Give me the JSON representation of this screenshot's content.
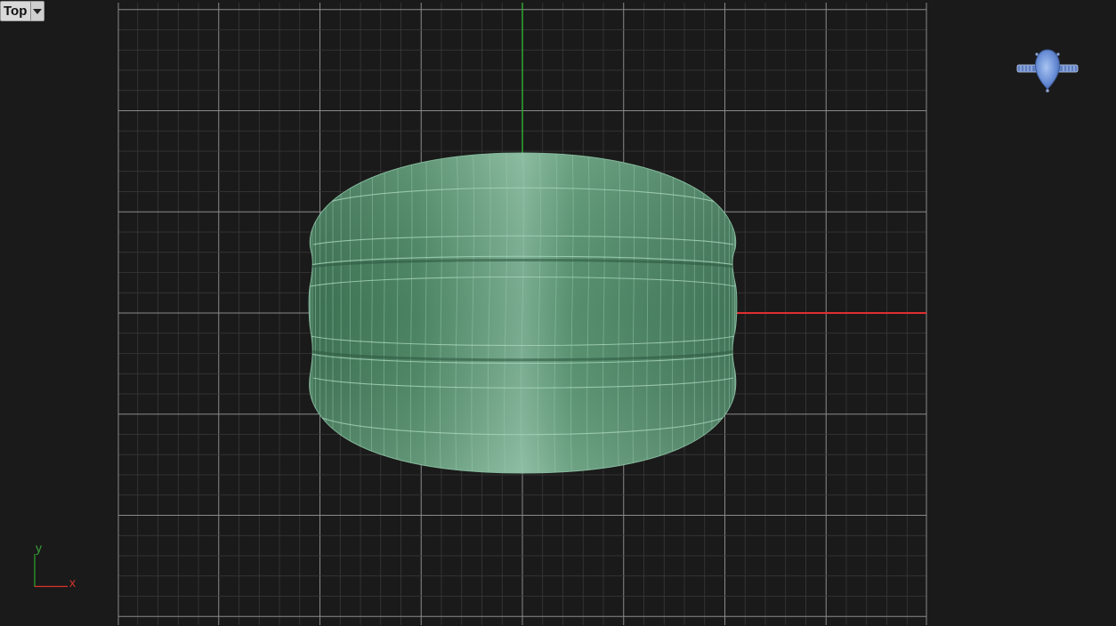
{
  "viewport": {
    "view_name": "Top",
    "background_color": "#1a1a1a",
    "grid_minor_color": "#3a3a3a",
    "grid_major_color": "#8a8a8a",
    "x_axis_color": "#e03030",
    "y_axis_color": "#2fa82f",
    "object_color": "#5a9a72"
  },
  "axis_indicator": {
    "x_label": "x",
    "y_label": "y"
  },
  "icons": {
    "view_dropdown": "chevron-down-icon",
    "view_widget": "ring-preview-icon"
  }
}
